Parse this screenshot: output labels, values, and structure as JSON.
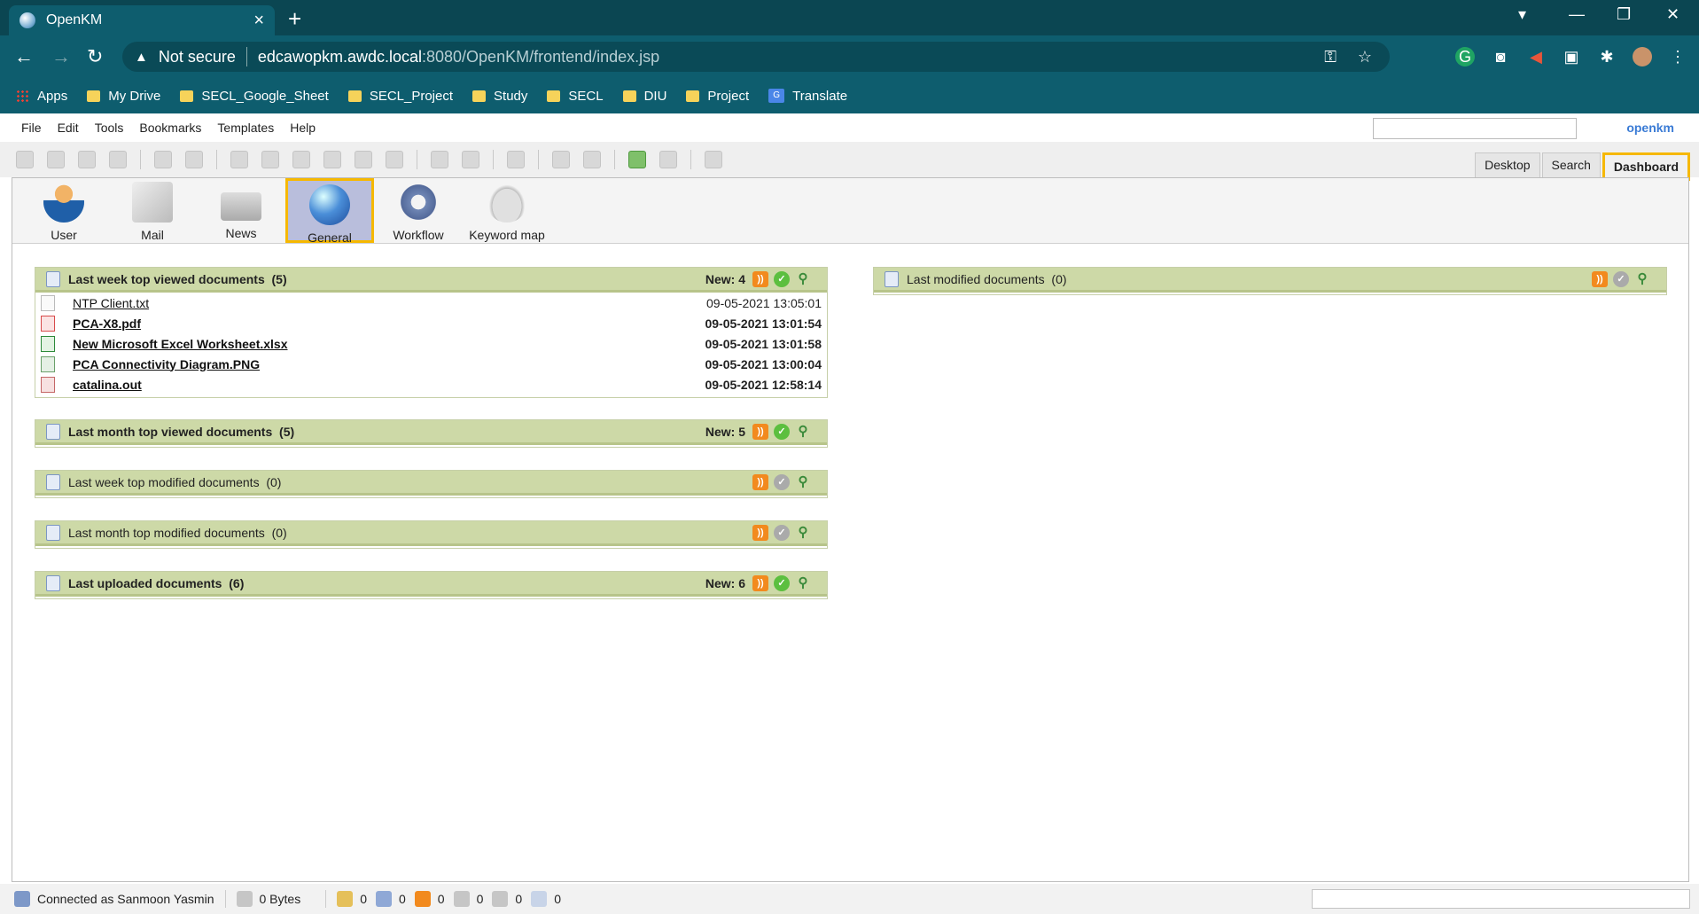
{
  "browser": {
    "tab_title": "OpenKM",
    "security_label": "Not secure",
    "url_host": "edcawopkm.awdc.local",
    "url_path": ":8080/OpenKM/frontend/index.jsp",
    "bookmarks": [
      "Apps",
      "My Drive",
      "SECL_Google_Sheet",
      "SECL_Project",
      "Study",
      "SECL",
      "DIU",
      "Project",
      "Translate"
    ]
  },
  "menu": [
    "File",
    "Edit",
    "Tools",
    "Bookmarks",
    "Templates",
    "Help"
  ],
  "logo": "openkm",
  "view_tabs": [
    "Desktop",
    "Search",
    "Dashboard"
  ],
  "dashboard_tabs": [
    "User",
    "Mail",
    "News",
    "General",
    "Workflow",
    "Keyword map"
  ],
  "panels": {
    "week_viewed": {
      "title": "Last week top viewed documents",
      "count": "(5)",
      "new": "New: 4"
    },
    "month_viewed": {
      "title": "Last month top viewed documents",
      "count": "(5)",
      "new": "New: 5"
    },
    "week_modified": {
      "title": "Last week top modified documents",
      "count": "(0)"
    },
    "month_modified": {
      "title": "Last month top modified documents",
      "count": "(0)"
    },
    "uploaded": {
      "title": "Last uploaded documents",
      "count": "(6)",
      "new": "New: 6"
    },
    "last_modified": {
      "title": "Last modified documents",
      "count": "(0)"
    }
  },
  "documents": [
    {
      "name": "NTP Client.txt",
      "date": "09-05-2021 13:05:01",
      "type": "txt",
      "is_new": false
    },
    {
      "name": "PCA-X8.pdf",
      "date": "09-05-2021 13:01:54",
      "type": "pdf",
      "is_new": true
    },
    {
      "name": "New Microsoft Excel Worksheet.xlsx",
      "date": "09-05-2021 13:01:58",
      "type": "xls",
      "is_new": true
    },
    {
      "name": "PCA Connectivity Diagram.PNG",
      "date": "09-05-2021 13:00:04",
      "type": "png",
      "is_new": true
    },
    {
      "name": "catalina.out",
      "date": "09-05-2021 12:58:14",
      "type": "out",
      "is_new": true
    }
  ],
  "status": {
    "connected": "Connected as Sanmoon Yasmin",
    "size": "0 Bytes",
    "counters": [
      "0",
      "0",
      "0",
      "0",
      "0",
      "0"
    ]
  },
  "colors": {
    "accent_highlight": "#f6b800",
    "panel_header": "#cdd9a7",
    "browser_bg": "#0e5d6e"
  }
}
